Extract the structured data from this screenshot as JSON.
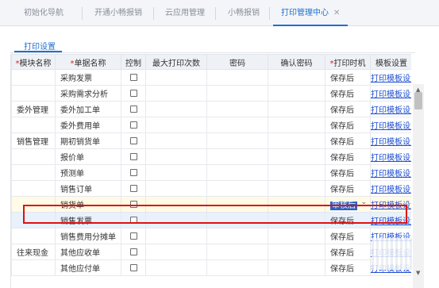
{
  "top_tabs": [
    {
      "label": "初始化导航"
    },
    {
      "label": "开通小畅报销"
    },
    {
      "label": "云应用管理"
    },
    {
      "label": "小畅报销"
    },
    {
      "label": "打印管理中心",
      "active": true,
      "close": "✕"
    }
  ],
  "sub_tab": {
    "label": "打印设置"
  },
  "table": {
    "headers": {
      "module": "模块名称",
      "doc": "单据名称",
      "control": "控制",
      "max_print": "最大打印次数",
      "password": "密码",
      "confirm_password": "确认密码",
      "print_time": "打印时机",
      "template": "模板设置",
      "req": "*"
    },
    "rows": [
      {
        "module": "",
        "doc": "采购发票",
        "print_time": "保存后",
        "template": "打印模板设置"
      },
      {
        "module": "",
        "doc": "采购需求分析",
        "print_time": "保存后",
        "template": "打印模板设置"
      },
      {
        "module": "委外管理",
        "doc": "委外加工单",
        "print_time": "保存后",
        "template": "打印模板设置"
      },
      {
        "module": "",
        "doc": "委外费用单",
        "print_time": "保存后",
        "template": "打印模板设置"
      },
      {
        "module": "销售管理",
        "doc": "期初销货单",
        "print_time": "保存后",
        "template": "打印模板设置"
      },
      {
        "module": "",
        "doc": "报价单",
        "print_time": "保存后",
        "template": "打印模板设置"
      },
      {
        "module": "",
        "doc": "预测单",
        "print_time": "保存后",
        "template": "打印模板设置"
      },
      {
        "module": "",
        "doc": "销售订单",
        "print_time": "保存后",
        "template": "打印模板设置"
      },
      {
        "module": "",
        "doc": "销货单",
        "print_time": "审核后",
        "template": "打印模板设置"
      },
      {
        "module": "",
        "doc": "销售发票",
        "print_time": "保存后",
        "template": "打印模板设置"
      },
      {
        "module": "",
        "doc": "销售费用分摊单",
        "print_time": "保存后",
        "template": "打印模板设置"
      },
      {
        "module": "往来现金",
        "doc": "其他应收单",
        "print_time": "保存后",
        "template": "打印模板设置"
      },
      {
        "module": "",
        "doc": "其他应付单",
        "print_time": "保存后",
        "template": "打印模板设置"
      }
    ]
  },
  "colors": {
    "accent": "#1f6fd1",
    "highlight_border": "#e01010",
    "link": "#1f4fd1"
  }
}
